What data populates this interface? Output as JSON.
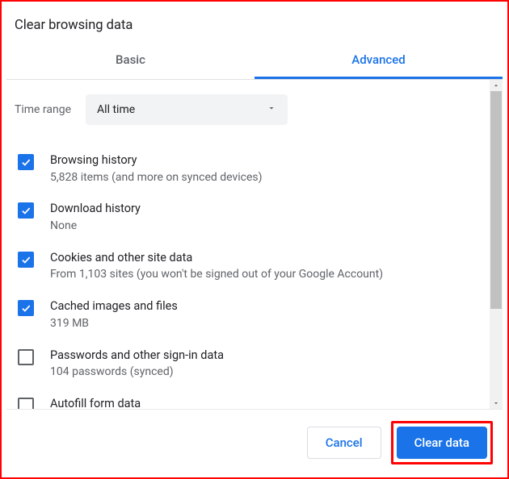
{
  "title": "Clear browsing data",
  "tabs": {
    "basic": "Basic",
    "advanced": "Advanced",
    "active": "advanced"
  },
  "time_range": {
    "label": "Time range",
    "value": "All time"
  },
  "options": [
    {
      "key": "browsing-history",
      "checked": true,
      "title": "Browsing history",
      "sub": "5,828 items (and more on synced devices)"
    },
    {
      "key": "download-history",
      "checked": true,
      "title": "Download history",
      "sub": "None"
    },
    {
      "key": "cookies",
      "checked": true,
      "title": "Cookies and other site data",
      "sub": "From 1,103 sites (you won't be signed out of your Google Account)"
    },
    {
      "key": "cache",
      "checked": true,
      "title": "Cached images and files",
      "sub": "319 MB"
    },
    {
      "key": "passwords",
      "checked": false,
      "title": "Passwords and other sign-in data",
      "sub": "104 passwords (synced)"
    },
    {
      "key": "autofill",
      "checked": false,
      "title": "Autofill form data",
      "sub": ""
    }
  ],
  "buttons": {
    "cancel": "Cancel",
    "clear": "Clear data"
  }
}
